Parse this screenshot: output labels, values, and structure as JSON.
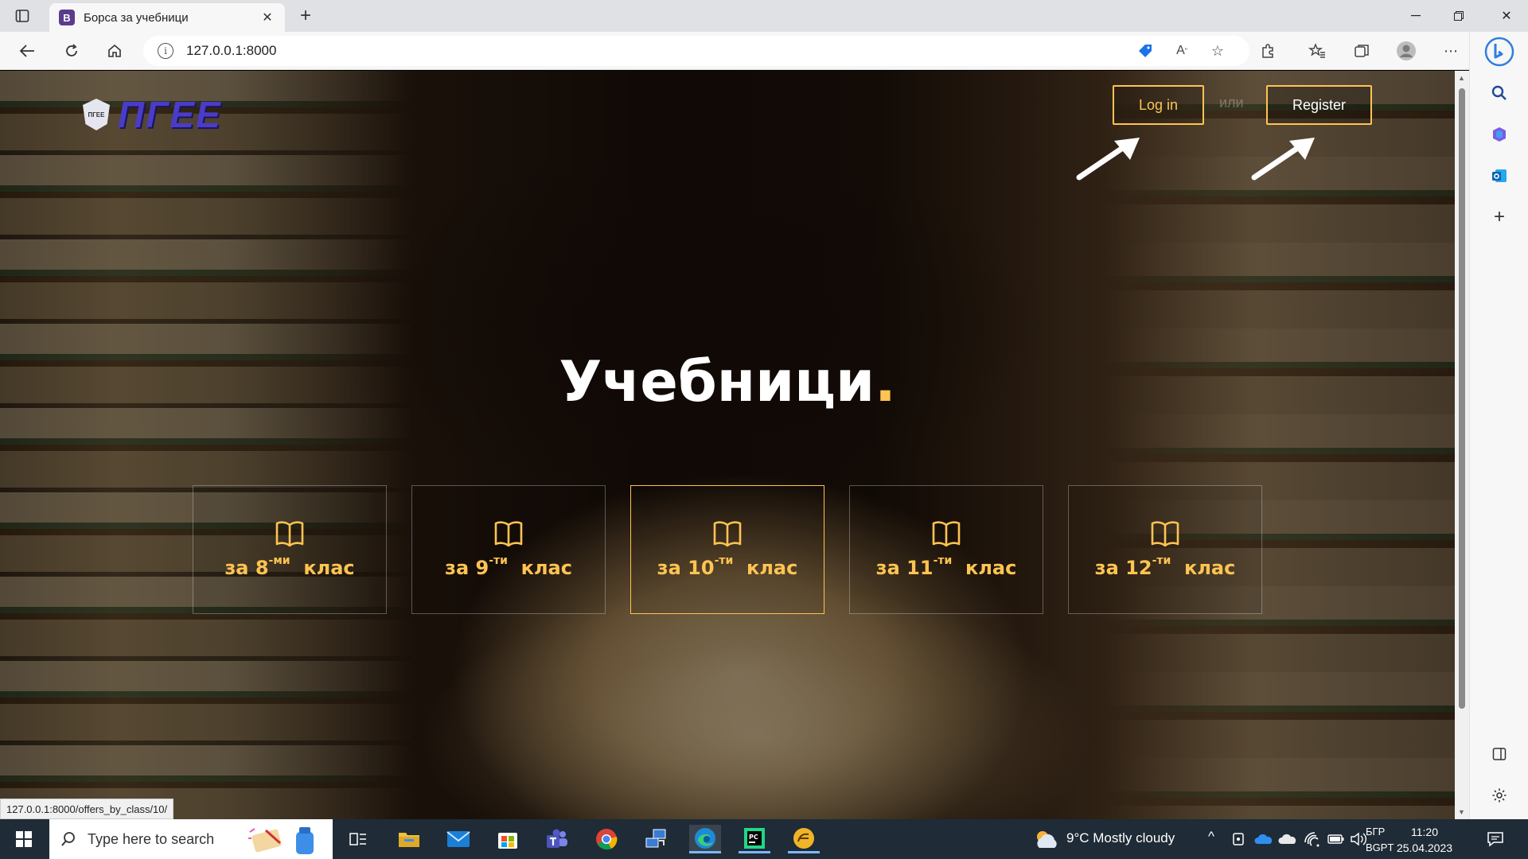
{
  "browser": {
    "tab_title": "Борса за учебници",
    "favicon_letter": "B",
    "url": "127.0.0.1:8000",
    "status_url": "127.0.0.1:8000/offers_by_class/10/"
  },
  "site": {
    "logo_text": "ПГЕЕ",
    "logo_badge_text": "ПГЕЕ",
    "login_label": "Log in",
    "or_label": "или",
    "register_label": "Register",
    "hero_title": "Учебници",
    "hero_dot": ".",
    "accent_color": "#ffc451",
    "classes": [
      {
        "prefix": "за 8",
        "sup": "-ми",
        "suffix": "клас"
      },
      {
        "prefix": "за 9",
        "sup": "-ти",
        "suffix": "клас"
      },
      {
        "prefix": "за 10",
        "sup": "-ти",
        "suffix": "клас"
      },
      {
        "prefix": "за 11",
        "sup": "-ти",
        "suffix": "клас"
      },
      {
        "prefix": "за 12",
        "sup": "-ти",
        "suffix": "клас"
      }
    ]
  },
  "taskbar": {
    "search_placeholder": "Type here to search",
    "weather": "9°C  Mostly cloudy",
    "lang_top": "БГР",
    "lang_bottom": "BGPT",
    "time": "11:20",
    "date": "25.04.2023"
  }
}
